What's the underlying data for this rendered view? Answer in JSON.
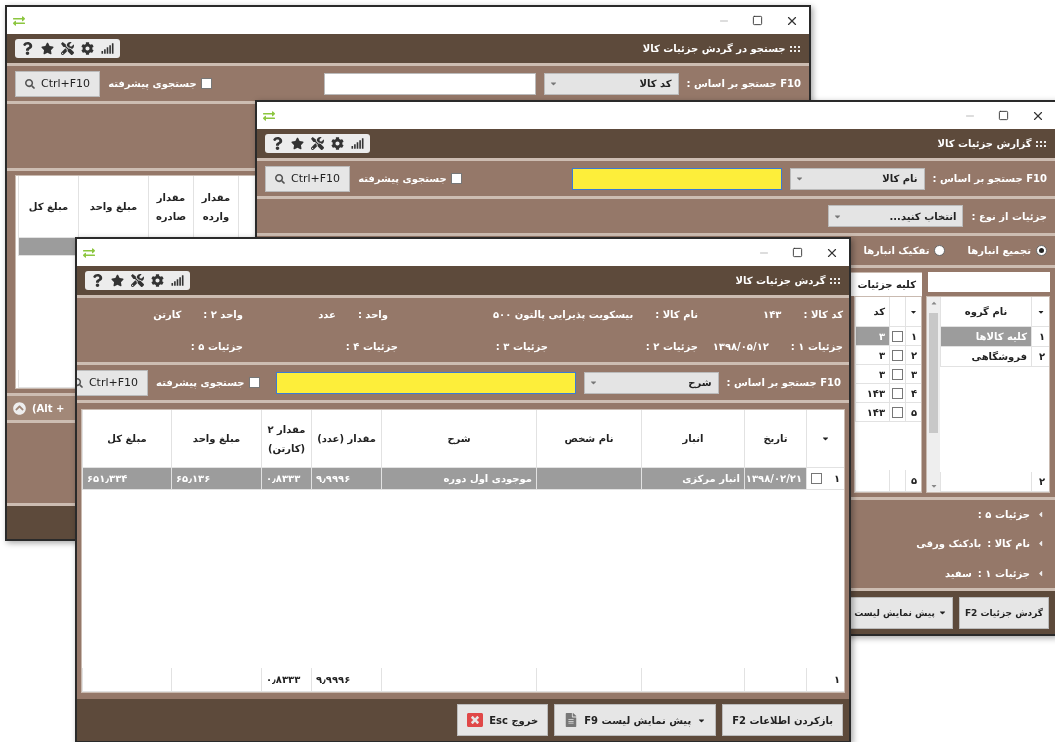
{
  "windows": [
    {
      "kind": "search",
      "title": "::: جستجو در گردش جزئیات کالا",
      "search": {
        "label": "F10 جستجو بر اساس :",
        "field": "کد کالا",
        "focused": false,
        "advanced_label": "جستجوی پیشرفته",
        "advanced_checked": false,
        "button": "Ctrl+F10"
      },
      "table": {
        "columns": [
          "مقدار وارده",
          "مقدار صادره",
          "مبلغ واحد",
          "مبلغ کل"
        ],
        "rows": [
          {
            "selected": true
          }
        ]
      },
      "collapse_bar": {
        "text": "(Alt +"
      }
    },
    {
      "kind": "report",
      "title": "::: گزارش جزئیات کالا",
      "search": {
        "label": "F10 جستجو بر اساس :",
        "field": "نام کالا",
        "focused": true,
        "advanced_label": "جستجوی پیشرفته",
        "advanced_checked": false,
        "button": "Ctrl+F10"
      },
      "type_filter": {
        "label": "جزئیات از نوع :",
        "value": "انتخاب کنید..."
      },
      "radios": [
        {
          "label": "تجمیع انبارها",
          "selected": true
        },
        {
          "label": "تفکیک انبارها",
          "selected": false
        }
      ],
      "groups": {
        "column": "نام گروه",
        "rows": [
          {
            "number": "۱",
            "name": "کلیه کالاها",
            "selected": true
          },
          {
            "number": "۲",
            "name": "فروشگاهی",
            "selected": false
          }
        ],
        "footer": "۲"
      },
      "details": {
        "tab": "کلیه جزئیات",
        "column": "کد",
        "rows": [
          {
            "number": "۱",
            "checked": false,
            "value": "۳",
            "selected": true
          },
          {
            "number": "۲",
            "checked": false,
            "value": "۳",
            "selected": false
          },
          {
            "number": "۳",
            "checked": false,
            "value": "۳",
            "selected": false
          },
          {
            "number": "۴",
            "checked": false,
            "value": "۱۴۳",
            "selected": false
          },
          {
            "number": "۵",
            "checked": false,
            "value": "۱۴۳",
            "selected": false
          }
        ],
        "footer": "۵"
      },
      "info_lines": [
        {
          "label": "جزئیات ۵ :"
        },
        {
          "label": "نام کالا :",
          "value": "بادکنک ورقی"
        },
        {
          "label": "جزئیات ۱ :",
          "value": "سفید"
        }
      ],
      "buttons": [
        {
          "kind": "plain",
          "label": "گردش جزئیات F2"
        },
        {
          "kind": "menu",
          "label": "پیش نمایش لیست"
        }
      ]
    },
    {
      "kind": "detail",
      "title": "::: گردش جزئیات کالا",
      "info_rows": [
        {
          "items": [
            {
              "label": "کد کالا :",
              "value": "۱۴۳"
            },
            {
              "label": "نام کالا :",
              "value": "بیسکویت پذیرایی پالتون ۵۰۰"
            },
            {
              "label": "واحد :",
              "value": "عدد"
            },
            {
              "label": "واحد ۲ :",
              "value": "کارتن"
            }
          ]
        },
        {
          "items": [
            {
              "label": "جزئیات ۱ :",
              "value": "۱۳۹۸/۰۵/۱۲"
            },
            {
              "label": "جزئیات ۲ :"
            },
            {
              "label": "جزئیات ۳ :"
            },
            {
              "label": "جزئیات ۴ :"
            },
            {
              "label": "جزئیات ۵ :"
            }
          ]
        }
      ],
      "search": {
        "label": "F10 جستجو بر اساس :",
        "field": "شرح",
        "focused": true,
        "advanced_label": "جستجوی پیشرفته",
        "advanced_checked": false,
        "button": "Ctrl+F10"
      },
      "table": {
        "columns": [
          "تاریخ",
          "انبار",
          "نام شخص",
          "شرح",
          "مقدار (عدد)",
          "مقدار ۲ (کارتن)",
          "مبلغ واحد",
          "مبلغ کل"
        ],
        "rows": [
          {
            "number": "۱",
            "checked": false,
            "selected": true,
            "cells": [
              "۱۳۹۸/۰۲/۲۱",
              "انبار مرکزی",
              null,
              "موجودی اول دوره",
              "۹٫۹۹۹۶",
              "۰٫۸۳۳۳",
              "۶۵٫۱۳۶",
              "۶۵۱٫۳۳۴"
            ]
          }
        ],
        "footer": {
          "number": "۱",
          "cells": [
            null,
            null,
            null,
            null,
            "۹٫۹۹۹۶",
            "۰٫۸۳۳۳",
            null,
            null
          ]
        }
      },
      "buttons": [
        {
          "kind": "plain",
          "label": "بازکردن اطلاعات F2"
        },
        {
          "kind": "menu",
          "label": "پیش نمایش لیست F9",
          "document_icon": true
        },
        {
          "kind": "exit",
          "label": "خروج Esc"
        }
      ]
    }
  ]
}
